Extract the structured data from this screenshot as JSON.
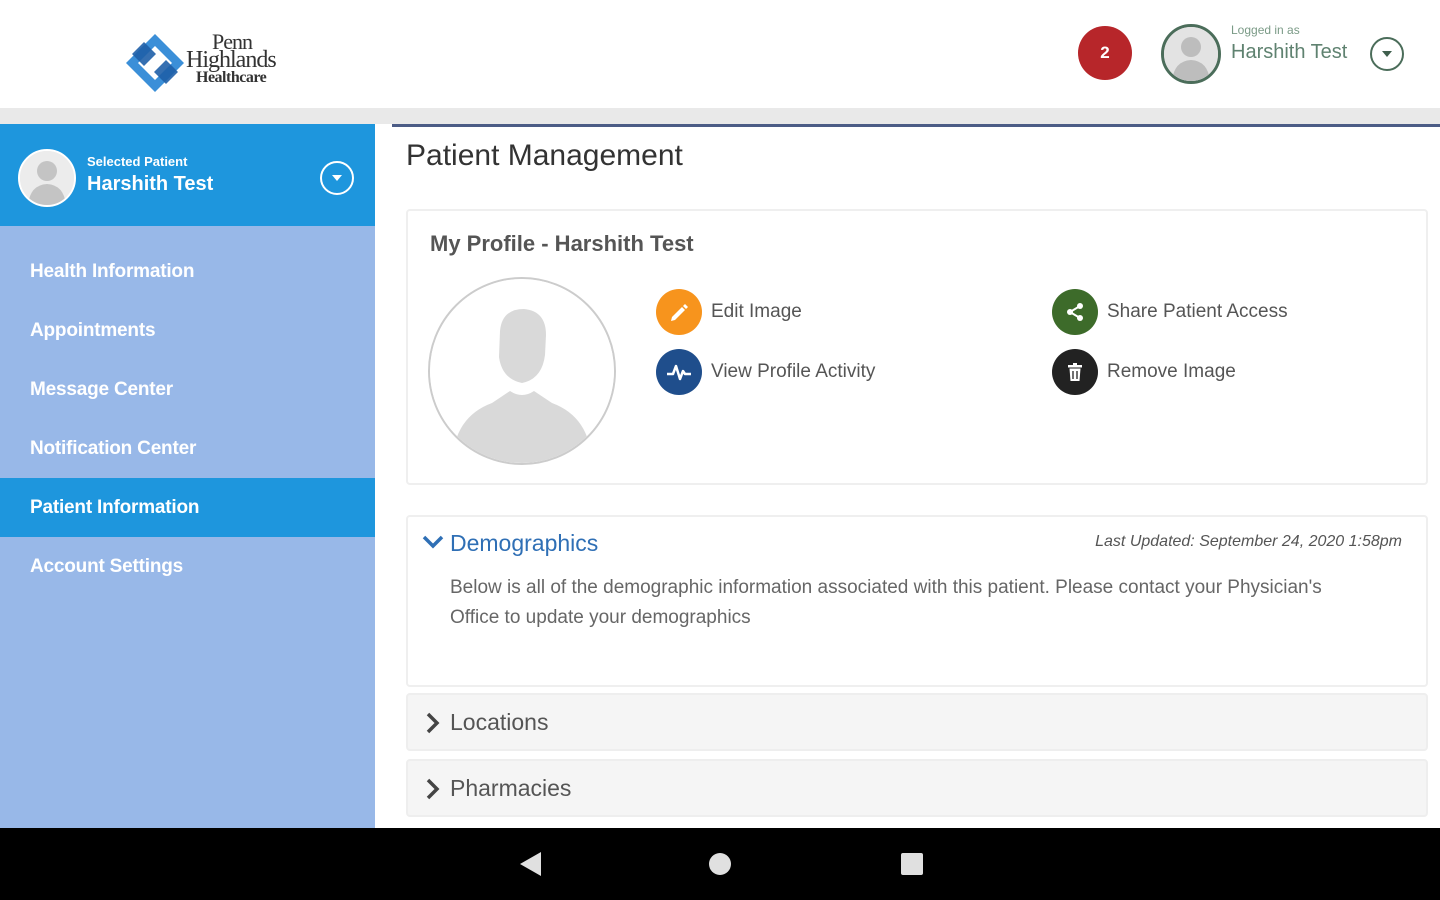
{
  "app": {
    "logo": {
      "line1": "Penn",
      "line2": "Highlands",
      "line3": "Healthcare"
    }
  },
  "header": {
    "notification_count": "2",
    "logged_in_label": "Logged in as",
    "user_name": "Harshith Test"
  },
  "sidebar": {
    "selected_patient_label": "Selected Patient",
    "selected_patient_name": "Harshith Test",
    "items": [
      {
        "label": "Health Information",
        "active": false
      },
      {
        "label": "Appointments",
        "active": false
      },
      {
        "label": "Message Center",
        "active": false
      },
      {
        "label": "Notification Center",
        "active": false
      },
      {
        "label": "Patient Information",
        "active": true
      },
      {
        "label": "Account Settings",
        "active": false
      }
    ]
  },
  "main": {
    "page_title": "Patient Management",
    "profile": {
      "title": "My Profile - Harshith Test",
      "actions": {
        "edit_image": "Edit Image",
        "view_profile_activity": "View Profile Activity",
        "share_patient_access": "Share Patient Access",
        "remove_image": "Remove Image"
      }
    },
    "demographics": {
      "title": "Demographics",
      "last_updated": "Last Updated: September 24, 2020 1:58pm",
      "description": "Below is all of the demographic information associated with this patient. Please contact your Physician's Office to update your demographics"
    },
    "sections": {
      "locations": "Locations",
      "pharmacies": "Pharmacies"
    }
  },
  "colors": {
    "primary_blue": "#1e96dd",
    "sidebar_bg": "#98b8e8",
    "badge_red": "#b7262a",
    "edit_orange": "#f7941d",
    "activity_navy": "#1f4e8c",
    "share_green": "#3d6b2a",
    "remove_black": "#222222"
  }
}
